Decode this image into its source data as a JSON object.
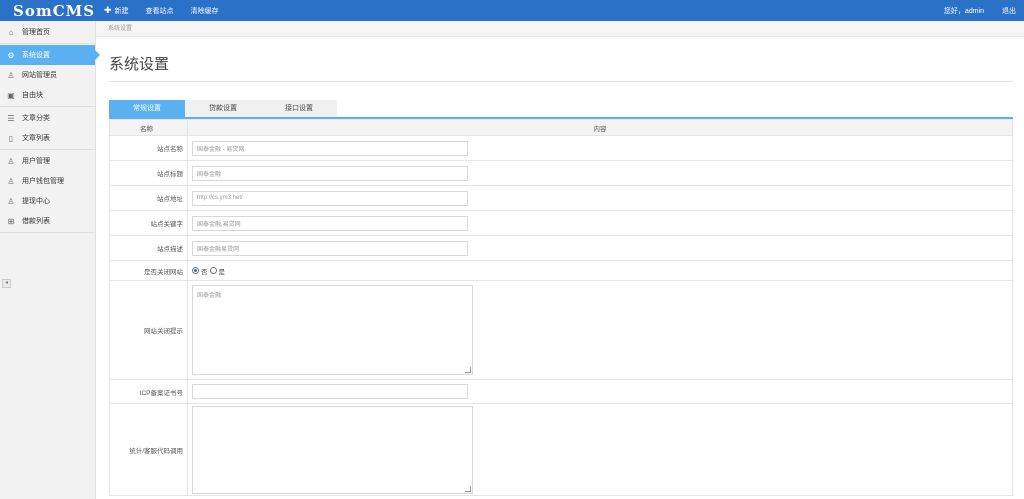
{
  "topbar": {
    "logo": "SomCMS",
    "nav": [
      {
        "label": "新建",
        "icon": "plus-icon"
      },
      {
        "label": "查看站点"
      },
      {
        "label": "清除缓存"
      }
    ],
    "greeting": "您好，admin",
    "logout": "退出",
    "color": "#2a72c7"
  },
  "sidebar": {
    "groups": [
      [
        {
          "label": "管理首页",
          "icon": "home-icon"
        }
      ],
      [
        {
          "label": "系统设置",
          "icon": "gear-icon",
          "active": true
        },
        {
          "label": "网站管理员",
          "icon": "user-icon"
        },
        {
          "label": "自由块",
          "icon": "block-icon"
        }
      ],
      [
        {
          "label": "文章分类",
          "icon": "category-icon"
        },
        {
          "label": "文章列表",
          "icon": "document-icon"
        }
      ],
      [
        {
          "label": "用户管理",
          "icon": "users-icon"
        },
        {
          "label": "用户钱包管理",
          "icon": "wallet-icon"
        },
        {
          "label": "提现中心",
          "icon": "withdraw-icon"
        },
        {
          "label": "借款列表",
          "icon": "grid-icon"
        }
      ]
    ],
    "active_color": "#5ab0f0"
  },
  "breadcrumb": "系统设置",
  "page_title": "系统设置",
  "tabs": [
    {
      "label": "常规设置",
      "active": true
    },
    {
      "label": "贷款设置"
    },
    {
      "label": "接口设置"
    }
  ],
  "table": {
    "header_name": "名称",
    "header_content": "内容",
    "rows": [
      {
        "label": "站点名称",
        "type": "input",
        "value": "国泰金融 - 易贷网"
      },
      {
        "label": "站点标题",
        "type": "input",
        "value": "国泰金融"
      },
      {
        "label": "站点地址",
        "type": "input",
        "value": "http://cs.ym3.net/"
      },
      {
        "label": "站点关键字",
        "type": "input",
        "value": "国泰金融,易贷网"
      },
      {
        "label": "站点描述",
        "type": "input",
        "value": "国泰金融易贷网"
      },
      {
        "label": "是否关闭网站",
        "type": "radio",
        "options": [
          "否",
          "是"
        ],
        "selected": "否"
      },
      {
        "label": "网站关闭提示",
        "type": "textarea",
        "value": "国泰金融"
      },
      {
        "label": "ICP备案证书号",
        "type": "input",
        "value": ""
      },
      {
        "label": "统计/客服代码调用",
        "type": "textarea",
        "value": ""
      }
    ]
  }
}
